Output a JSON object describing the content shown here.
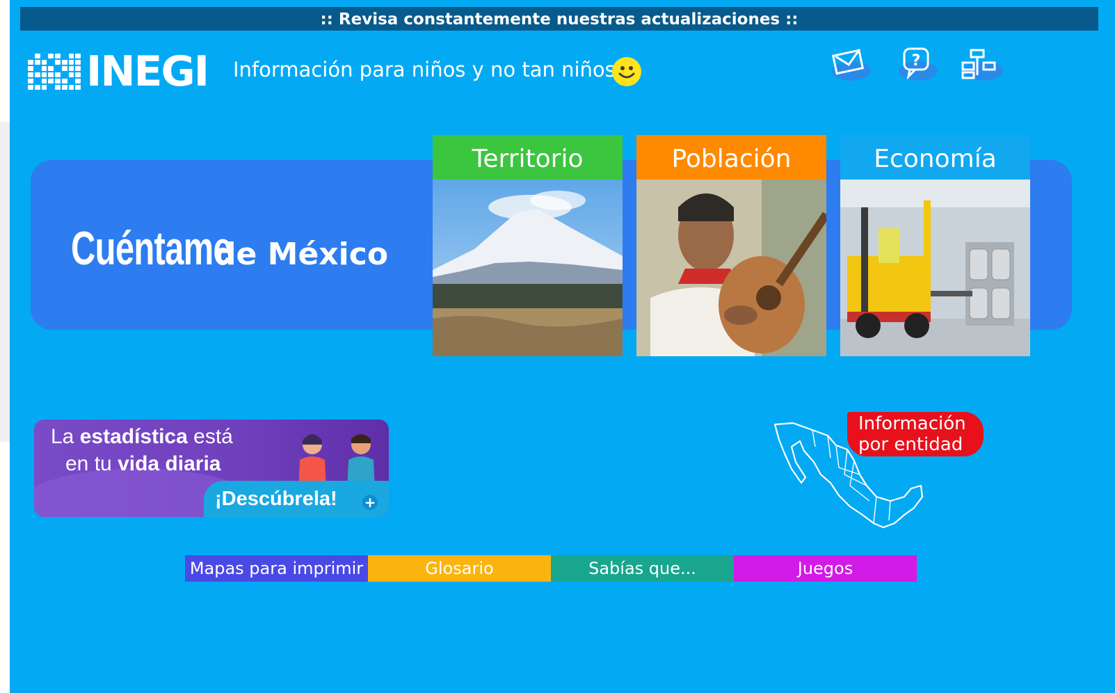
{
  "banner": {
    "text": ":: Revisa constantemente nuestras actualizaciones ::"
  },
  "header": {
    "logo_text": "INEGI",
    "tagline": "Información para niños y no tan niños",
    "icons": [
      "mail-icon",
      "help-icon",
      "sitemap-icon"
    ]
  },
  "hero": {
    "title_big": "Cuéntame",
    "title_small": "de México",
    "cards": [
      {
        "label": "Territorio",
        "color": "#3cc53f",
        "image": "volcano"
      },
      {
        "label": "Población",
        "color": "#ff8a00",
        "image": "guitar-player"
      },
      {
        "label": "Economía",
        "color": "#11a8f0",
        "image": "forklift-warehouse"
      }
    ]
  },
  "promo": {
    "line1_pre": "La ",
    "line1_bold": "estadística",
    "line1_post": " está",
    "line2_pre": "en tu ",
    "line2_bold": "vida diaria",
    "cta": "¡Descúbrela!",
    "plus": "+"
  },
  "entidad": {
    "line1": "Información",
    "line2": "por entidad"
  },
  "nav": [
    {
      "label": "Mapas para imprimir",
      "color": "#4a49e6"
    },
    {
      "label": "Glosario",
      "color": "#fbb40f"
    },
    {
      "label": "Sabías que...",
      "color": "#19a68e"
    },
    {
      "label": "Juegos",
      "color": "#d21be7"
    }
  ]
}
